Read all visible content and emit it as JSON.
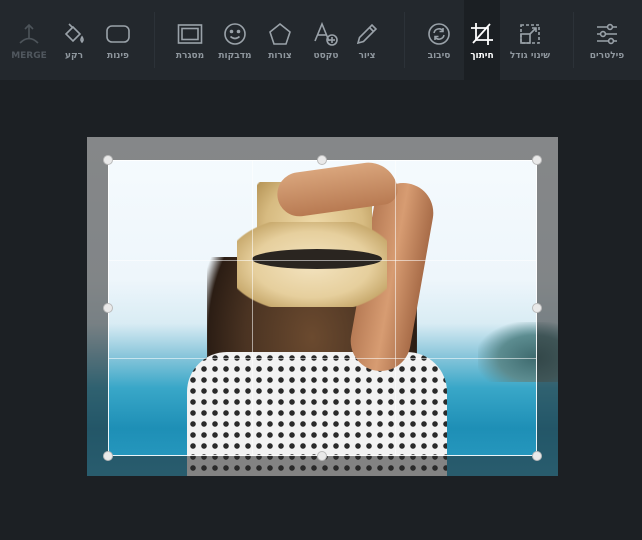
{
  "toolbar": {
    "tools": [
      {
        "id": "filters",
        "label": "פילטרים",
        "icon": "sliders-icon"
      },
      {
        "id": "resize",
        "label": "שינוי גודל",
        "icon": "resize-icon"
      },
      {
        "id": "crop",
        "label": "חיתוך",
        "icon": "crop-icon",
        "active": true
      },
      {
        "id": "rotate",
        "label": "סיבוב",
        "icon": "rotate-icon"
      },
      {
        "id": "draw",
        "label": "ציור",
        "icon": "pencil-icon"
      },
      {
        "id": "text",
        "label": "טקסט",
        "icon": "add-text-icon"
      },
      {
        "id": "shapes",
        "label": "צורות",
        "icon": "pentagon-icon"
      },
      {
        "id": "stickers",
        "label": "מדבקות",
        "icon": "smiley-icon"
      },
      {
        "id": "frames",
        "label": "מסגרת",
        "icon": "frame-icon"
      },
      {
        "id": "corners",
        "label": "פינות",
        "icon": "rounded-corners-icon"
      },
      {
        "id": "background",
        "label": "רקע",
        "icon": "paint-bucket-icon"
      },
      {
        "id": "merge",
        "label": "MERGE",
        "icon": "merge-icon",
        "disabled": true
      }
    ]
  },
  "colors": {
    "toolbar_bg": "#23282d",
    "canvas_bg": "#1c2024",
    "active_tab_bg": "#1b1f23",
    "label": "#8f979e",
    "active_label": "#ffffff"
  }
}
